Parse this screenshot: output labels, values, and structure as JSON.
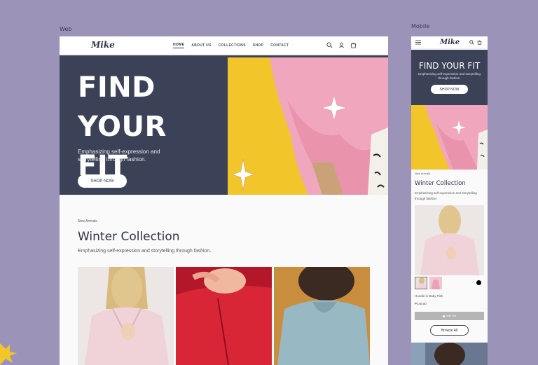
{
  "labels": {
    "web": "Web",
    "mobile": "Mobile"
  },
  "brand": {
    "logo": "Mike",
    "accent": "#3b4156",
    "hero_image_bg": "#f2c62a",
    "page_bg": "#9b94b8"
  },
  "web": {
    "nav": {
      "links": [
        {
          "label": "HOME",
          "active": true
        },
        {
          "label": "ABOUT US",
          "active": false
        },
        {
          "label": "COLLECTIONS",
          "active": false
        },
        {
          "label": "SHOP",
          "active": false
        },
        {
          "label": "CONTACT",
          "active": false
        }
      ],
      "icons": [
        "search-icon",
        "account-icon",
        "cart-icon"
      ]
    },
    "hero": {
      "title_line1": "FIND",
      "title_line2": "YOUR FIT",
      "subtitle": "Emphasizing self-expression and storytelling through fashion.",
      "button": "SHOP NOW"
    },
    "collection": {
      "eyebrow": "New Arrivals",
      "title": "Winter Collection",
      "subtitle": "Emphasizing self-expression and storytelling through fashion."
    }
  },
  "mobile": {
    "hero": {
      "title": "FIND YOUR FIT",
      "subtitle": "Emphasizing self-expression and storytelling through fashion.",
      "button": "SHOP NOW"
    },
    "collection": {
      "eyebrow": "New Arrivals",
      "title": "Winter Collection",
      "subtitle": "Emphasizing self-expression and storytelling through fashion."
    },
    "product": {
      "name": "Hoodie in Baby Pink",
      "price": "₱148.00",
      "sold_out": "Sold Out",
      "browse": "Browse All"
    }
  }
}
